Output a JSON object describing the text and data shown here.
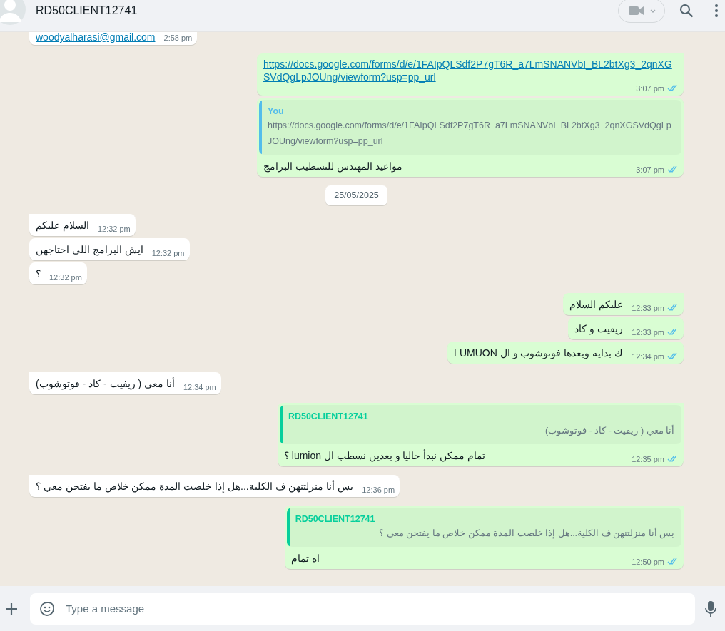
{
  "header": {
    "title": "RD50CLIENT12741"
  },
  "messages": [
    {
      "kind": "in",
      "tail": false,
      "link": "woodyalharasi@gmail.com",
      "time": "2:58 pm"
    },
    {
      "kind": "out",
      "tail": true,
      "link": "https://docs.google.com/forms/d/e/1FAIpQLSdf2P7gT6R_a7LmSNANVbI_BL2btXg3_2qnXGSVdQgLpJOUng/viewform?usp=pp_url",
      "time": "3:07 pm",
      "read": true
    },
    {
      "kind": "out",
      "tail": false,
      "quote": {
        "author": "You",
        "text": "https://docs.google.com/forms/d/e/1FAIpQLSdf2P7gT6R_a7LmSNANVbI_BL2btXg3_2qnXGSVdQgLpJOUng/viewform?usp=pp_url",
        "color": "#53bdeb"
      },
      "text": "مواعيد المهندس للتسطيب البرامج",
      "time": "3:07 pm",
      "read": true
    },
    {
      "kind": "date",
      "text": "25/05/2025"
    },
    {
      "kind": "in",
      "tail": true,
      "text": "السلام عليكم",
      "time": "12:32 pm"
    },
    {
      "kind": "in",
      "tail": false,
      "text": "ايش البرامج اللي احتاجهن",
      "time": "12:32 pm"
    },
    {
      "kind": "in",
      "tail": false,
      "text": "؟",
      "time": "12:32 pm"
    },
    {
      "kind": "out",
      "tail": true,
      "text": "عليكم السلام",
      "time": "12:33 pm",
      "read": true
    },
    {
      "kind": "out",
      "tail": false,
      "text": "ريفيت و كاد",
      "time": "12:33 pm",
      "read": true
    },
    {
      "kind": "out",
      "tail": false,
      "text": "ك بدايه وبعدها فوتوشوب و ال LUMUON",
      "time": "12:34 pm",
      "read": true
    },
    {
      "kind": "in",
      "tail": true,
      "text": "أنا معي ( ريفيت - كاد - فوتوشوب)",
      "time": "12:34 pm"
    },
    {
      "kind": "out",
      "tail": true,
      "quote": {
        "author": "RD50CLIENT12741",
        "text": "أنا معي ( ريفيت - كاد - فوتوشوب)",
        "color": "#06cf9c"
      },
      "text": "تمام ممكن نبدأ حاليا و بعدين نسطب ال lumion ؟",
      "time": "12:35 pm",
      "read": true
    },
    {
      "kind": "in",
      "tail": true,
      "text": "بس أنا منزلتنهن ف الكلية...هل إذا خلصت المدة ممكن خلاص ما يفتحن معي ؟",
      "time": "12:36 pm"
    },
    {
      "kind": "out",
      "tail": true,
      "quote": {
        "author": "RD50CLIENT12741",
        "text": "بس أنا منزلتنهن ف الكلية...هل إذا خلصت المدة ممكن خلاص ما يفتحن معي ؟",
        "color": "#06cf9c"
      },
      "text": "اه  تمام",
      "time": "12:50 pm",
      "read": true
    }
  ],
  "composer": {
    "placeholder": "Type a message"
  }
}
